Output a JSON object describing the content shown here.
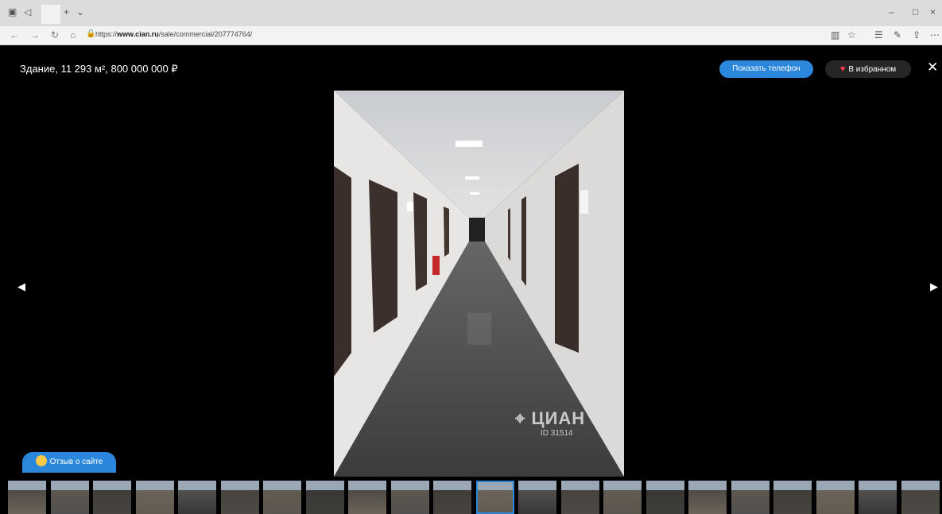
{
  "browser": {
    "url_prefix": "https://",
    "url_domain": "www.cian.ru",
    "url_path": "/sale/commercial/207774764/",
    "window_controls": [
      "–",
      "□",
      "×"
    ]
  },
  "gallery": {
    "title": "Здание, 11 293 м², 800 000 000 ₽",
    "show_phone_label": "Показать телефон",
    "favorite_label": "В избранном",
    "close_symbol": "✕",
    "prev_symbol": "◀",
    "next_symbol": "▶",
    "watermark_logo": "ЦИАН",
    "watermark_id": "ID 31514",
    "thumbnail_count": 22,
    "active_thumbnail_index": 11
  },
  "feedback": {
    "label": "Отзыв о сайте"
  },
  "colors": {
    "accent": "#2b87db",
    "heart": "#ff3b55"
  }
}
